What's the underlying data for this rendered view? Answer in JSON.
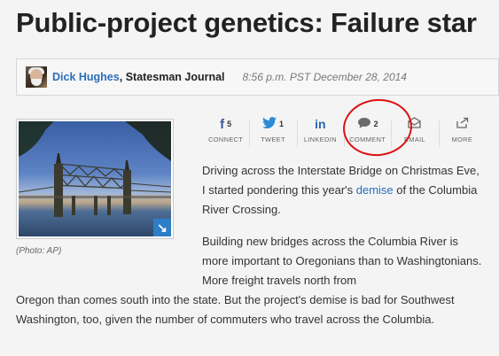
{
  "article": {
    "headline": "Public-project genetics: Failure star",
    "author": "Dick Hughes",
    "separator": ",",
    "outlet": "Statesman Journal",
    "timestamp": "8:56 p.m. PST December 28, 2014"
  },
  "photo": {
    "caption": "(Photo: AP)",
    "expand_glyph": "↘"
  },
  "share": [
    {
      "icon": "f",
      "count": "5",
      "label": "CONNECT"
    },
    {
      "icon": "🐦",
      "count": "1",
      "label": "TWEET"
    },
    {
      "icon": "in",
      "count": "",
      "label": "LINKEDIN"
    },
    {
      "icon": "💬",
      "count": "2",
      "label": "COMMENT"
    },
    {
      "icon": "✉",
      "count": "",
      "label": "EMAIL"
    },
    {
      "icon": "↗",
      "count": "",
      "label": "MORE"
    }
  ],
  "body": {
    "p1_before": "Driving across the Interstate Bridge on Christmas Eve, I started pondering this year's ",
    "p1_link": "demise",
    "p1_after": " of the Columbia River Crossing.",
    "p2": "Building new bridges across the Columbia River is more important to Oregonians than to Washingtonians. More freight travels north from",
    "p3": "Oregon than comes south into the state. But the project's demise is bad for Southwest Washington, too, given the number of commuters who travel across the Columbia."
  },
  "colors": {
    "link": "#2a6ebb",
    "facebook": "#3b5998",
    "twitter": "#2e8bd6",
    "annotation": "#dd1111"
  }
}
